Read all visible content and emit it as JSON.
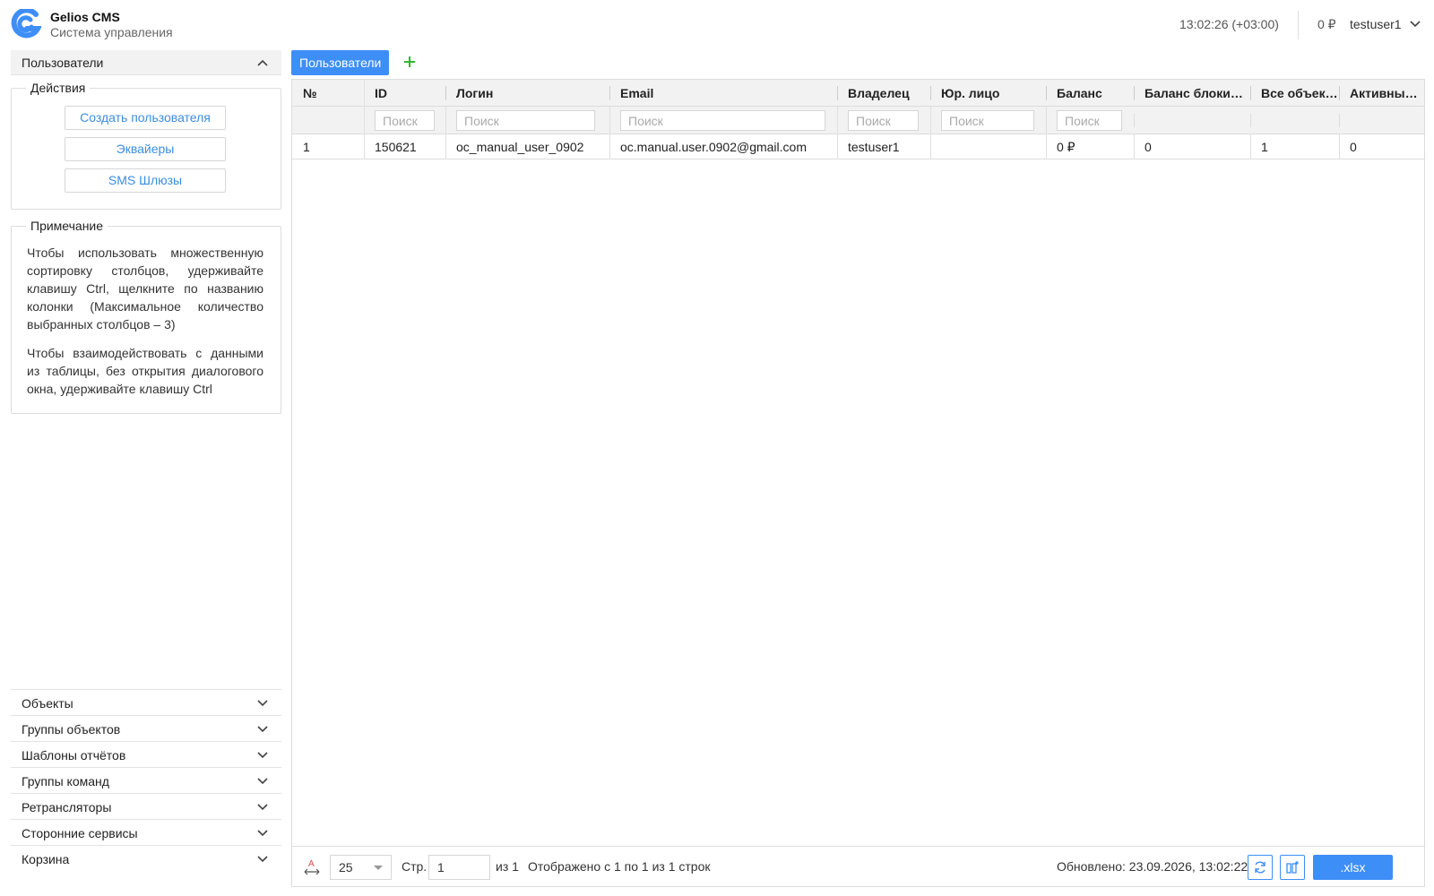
{
  "header": {
    "title": "Gelios CMS",
    "subtitle": "Система управления",
    "time": "13:02:26 (+03:00)",
    "balance": "0 ₽",
    "user": "testuser1"
  },
  "sidebar": {
    "users_section": "Пользователи",
    "actions_legend": "Действия",
    "actions": [
      "Создать пользователя",
      "Эквайеры",
      "SMS Шлюзы"
    ],
    "note_legend": "Примечание",
    "note_paragraphs": [
      "Чтобы использовать множественную сортировку столбцов, удерживайте клавишу Ctrl, щелкните по названию колонки (Максимальное количество выбранных столбцов – 3)",
      "Чтобы взаимодействовать с данными из таблицы, без открытия диалогового окна, удерживайте клавишу Ctrl"
    ],
    "sections": [
      "Объекты",
      "Группы объектов",
      "Шаблоны отчётов",
      "Группы команд",
      "Ретрансляторы",
      "Сторонние сервисы",
      "Корзина"
    ]
  },
  "tabs": {
    "active": "Пользователи"
  },
  "table": {
    "columns": [
      "№",
      "ID",
      "Логин",
      "Email",
      "Владелец",
      "Юр. лицо",
      "Баланс",
      "Баланс блокировки",
      "Все объекты",
      "Активные объекты"
    ],
    "filter_placeholder": "Поиск",
    "rows": [
      [
        "1",
        "150621",
        "oc_manual_user_0902",
        "oc.manual.user.0902@gmail.com",
        "testuser1",
        "",
        "0 ₽",
        "0",
        "1",
        "0"
      ]
    ]
  },
  "footer": {
    "page_size": "25",
    "page_label": "Стр.",
    "page_value": "1",
    "of_pages": "из 1",
    "shown": "Отображено с 1 по 1 из 1 строк",
    "updated": "Обновлено: 23.09.2026, 13:02:22",
    "export_label": ".xlsx"
  },
  "colors": {
    "accent": "#3e8ef7",
    "add": "#2eb82e",
    "link": "#3c8ee0"
  }
}
